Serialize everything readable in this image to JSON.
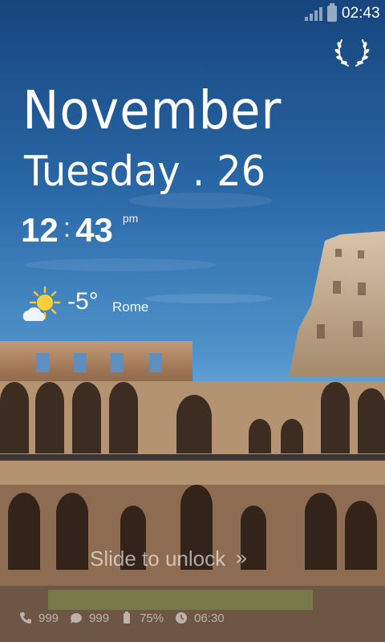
{
  "status_bar": {
    "time": "02:43",
    "signal_icon": "signal-icon",
    "battery_icon": "battery-icon"
  },
  "theme_icon": "laurel-wreath-icon",
  "date": {
    "month": "November",
    "day_line": "Tuesday . 26"
  },
  "clock": {
    "hours": "12",
    "separator": ":",
    "minutes": "43",
    "ampm": "pm"
  },
  "weather": {
    "icon": "partly-sunny-icon",
    "temperature": "-5°",
    "city": "Rome"
  },
  "unlock": {
    "label": "Slide to unlock",
    "arrow": "»"
  },
  "notifications": [
    {
      "icon": "phone-icon",
      "value": "999"
    },
    {
      "icon": "message-icon",
      "value": "999"
    },
    {
      "icon": "battery-icon",
      "value": "75%"
    },
    {
      "icon": "alarm-icon",
      "value": "06:30"
    }
  ],
  "colors": {
    "sky_top": "#1a4a80",
    "sky_bottom": "#6aaad7",
    "stone": "#a0785a"
  }
}
